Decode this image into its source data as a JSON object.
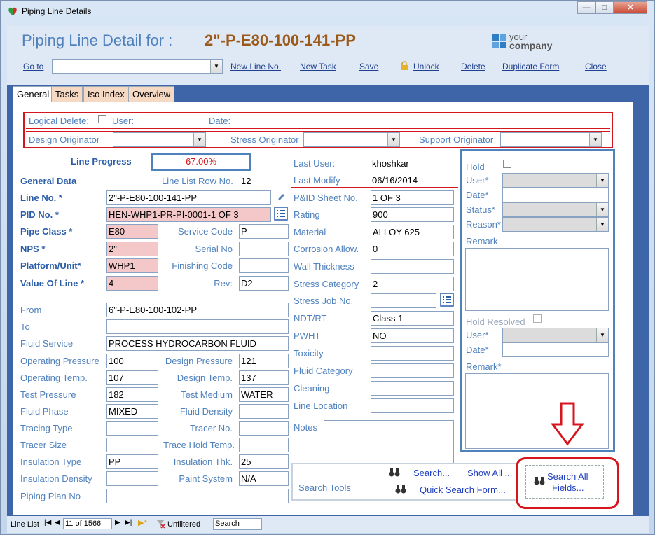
{
  "window": {
    "title": "Piping Line Details"
  },
  "header": {
    "title": "Piping Line Detail for :",
    "line_no": "2\"-P-E80-100-141-PP",
    "logo_line1": "your",
    "logo_line2": "company"
  },
  "commands": {
    "goto": "Go to",
    "new_line": "New Line No.",
    "new_task": "New Task",
    "save": "Save",
    "unlock": "Unlock",
    "delete": "Delete",
    "duplicate": "Duplicate Form",
    "close": "Close"
  },
  "tabs": [
    "General",
    "Tasks",
    "Iso Index",
    "Overview"
  ],
  "top": {
    "logical_delete": "Logical Delete:",
    "user": "User:",
    "date": "Date:",
    "design_originator": "Design Originator",
    "stress_originator": "Stress Originator",
    "support_originator": "Support Originator"
  },
  "progress": {
    "label": "Line Progress",
    "value": "67.00%"
  },
  "general": {
    "general_data": "General Data",
    "line_list_row_no_label": "Line List Row No.",
    "line_list_row_no": "12",
    "line_no_label": "Line No. *",
    "line_no": "2\"-P-E80-100-141-PP",
    "pid_no_label": "PID No. *",
    "pid_no": "HEN-WHP1-PR-PI-0001-1 OF 3",
    "pipe_class_label": "Pipe Class *",
    "pipe_class": "E80",
    "service_code_label": "Service Code",
    "service_code": "P",
    "nps_label": "NPS *",
    "nps": "2\"",
    "serial_no_label": "Serial No",
    "serial_no": "",
    "platform_label": "Platform/Unit*",
    "platform": "WHP1",
    "finishing_code_label": "Finishing Code",
    "finishing_code": "",
    "value_of_line_label": "Value Of Line *",
    "value_of_line": "4",
    "rev_label": "Rev:",
    "rev": "D2",
    "from_label": "From",
    "from": "6\"-P-E80-100-102-PP",
    "to_label": "To",
    "to": "",
    "fluid_service_label": "Fluid Service",
    "fluid_service": "PROCESS HYDROCARBON FLUID",
    "op_pressure_label": "Operating Pressure",
    "op_pressure": "100",
    "design_pressure_label": "Design Pressure",
    "design_pressure": "121",
    "op_temp_label": "Operating Temp.",
    "op_temp": "107",
    "design_temp_label": "Design Temp.",
    "design_temp": "137",
    "test_pressure_label": "Test Pressure",
    "test_pressure": "182",
    "test_medium_label": "Test Medium",
    "test_medium": "WATER",
    "fluid_phase_label": "Fluid Phase",
    "fluid_phase": "MIXED",
    "fluid_density_label": "Fluid Density",
    "fluid_density": "",
    "tracing_type_label": "Tracing Type",
    "tracing_type": "",
    "tracer_no_label": "Tracer No.",
    "tracer_no": "",
    "tracer_size_label": "Tracer Size",
    "tracer_size": "",
    "trace_hold_temp_label": "Trace Hold Temp.",
    "trace_hold_temp": "",
    "insulation_type_label": "Insulation Type",
    "insulation_type": "PP",
    "insulation_thk_label": "Insulation Thk.",
    "insulation_thk": "25",
    "insulation_density_label": "Insulation Density",
    "insulation_density": "",
    "paint_system_label": "Paint System",
    "paint_system": "N/A",
    "piping_plan_no_label": "Piping Plan No",
    "piping_plan_no": ""
  },
  "middle": {
    "last_user_label": "Last User:",
    "last_user": "khoshkar",
    "last_modify_label": "Last Modify",
    "last_modify": "06/16/2014",
    "pid_sheet_label": "P&ID Sheet No.",
    "pid_sheet": "1 OF 3",
    "rating_label": "Rating",
    "rating": "900",
    "material_label": "Material",
    "material": "ALLOY 625",
    "corrosion_label": "Corrosion Allow.",
    "corrosion": "0",
    "wall_thickness_label": "Wall Thickness",
    "wall_thickness": "",
    "stress_category_label": "Stress Category",
    "stress_category": "2",
    "stress_job_label": "Stress Job No.",
    "stress_job": "",
    "ndt_label": "NDT/RT",
    "ndt": "Class 1",
    "pwht_label": "PWHT",
    "pwht": "NO",
    "toxicity_label": "Toxicity",
    "toxicity": "",
    "fluid_category_label": "Fluid Category",
    "fluid_category": "",
    "cleaning_label": "Cleaning",
    "cleaning": "",
    "line_location_label": "Line Location",
    "line_location": "",
    "notes_label": "Notes"
  },
  "hold": {
    "hold_label": "Hold",
    "user_label": "User*",
    "date_label": "Date*",
    "status_label": "Status*",
    "reason_label": "Reason*",
    "remark_label": "Remark",
    "hold_resolved_label": "Hold Resolved",
    "res_user_label": "User*",
    "res_date_label": "Date*",
    "res_remark_label": "Remark*"
  },
  "search": {
    "label": "Search Tools",
    "search": "Search...",
    "show_all": "Show All ...",
    "quick": "Quick Search Form...",
    "search_all_1": "Search All",
    "search_all_2": "Fields..."
  },
  "statusbar": {
    "record_label": "Line List",
    "record": "11 of 1566",
    "filter": "Unfiltered",
    "search": "Search"
  },
  "colors": {
    "label_blue": "#4f81bd",
    "highlight_red": "#d5161c",
    "required_pink": "#f4c8c8"
  }
}
